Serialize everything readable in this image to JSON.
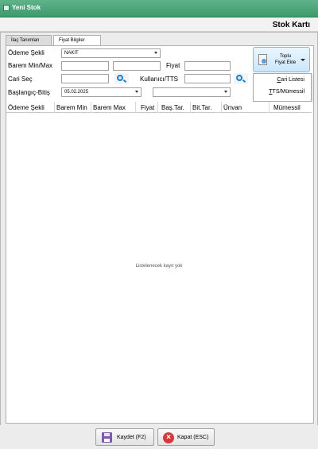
{
  "window": {
    "title": "Yeni Stok"
  },
  "header": {
    "form_title": "Stok Kartı"
  },
  "tabs": [
    {
      "label": "İlaç Tanımları",
      "active": false
    },
    {
      "label": "Fiyat Bilgiler",
      "active": true
    }
  ],
  "form": {
    "odeme_sekli": {
      "label": "Ödeme Şekli",
      "value": "NAKIT"
    },
    "barem": {
      "label": "Barem Min/Max",
      "min_value": "",
      "max_value": ""
    },
    "fiyat": {
      "label": "Fiyat",
      "value": ""
    },
    "cari": {
      "label": "Cari Seç",
      "value": ""
    },
    "kullanici": {
      "label": "Kullanıcı/TTS",
      "value": ""
    },
    "baslangic": {
      "label": "Başlangıç-Bitiş",
      "start_value": "05.02.2025",
      "end_value": ""
    }
  },
  "toplu_button": {
    "label_line1": "Toplu",
    "label_line2": "Fiyat Ekle"
  },
  "dropdown_menu": {
    "items": [
      {
        "label_underlined": "C",
        "label_rest": "ari Listesi"
      },
      {
        "label_underlined": "T",
        "label_rest": "TS/Mümessil"
      }
    ]
  },
  "grid": {
    "columns": [
      "Ödeme Şekli",
      "Barem Min",
      "Barem Max",
      "Fiyat",
      "Baş.Tar.",
      "Bit.Tar.",
      "Ünvan",
      "Mümessil"
    ],
    "empty_message": "Listelenecek kayıt yok"
  },
  "footer": {
    "save_label": "Kaydet (F2)",
    "close_label": "Kapat (ESC)"
  },
  "colors": {
    "titlebar": "#4aa77b",
    "accent_blue": "#1f7fc6",
    "close_red": "#d13b3b",
    "save_purple": "#7a5ca8"
  },
  "icons": [
    "app-icon",
    "search-icon",
    "document-icon",
    "chevron-down-icon",
    "save-icon",
    "close-icon"
  ]
}
